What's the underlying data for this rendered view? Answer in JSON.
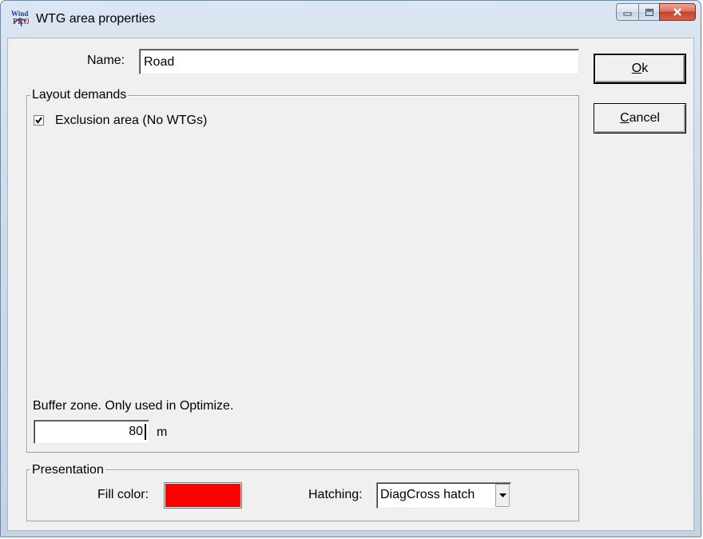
{
  "window": {
    "title": "WTG area properties",
    "icon": "windpro-app-icon",
    "controls": {
      "minimize": "minimize-icon",
      "maximize": "maximize-icon",
      "close": "close-icon"
    }
  },
  "form": {
    "name_label": "Name:",
    "name_value": "Road"
  },
  "buttons": {
    "ok_prefix": "",
    "ok_underlined": "O",
    "ok_rest": "k",
    "cancel_underlined": "C",
    "cancel_rest": "ancel"
  },
  "layout_demands": {
    "group_title": "Layout demands",
    "exclusion_label": "Exclusion area (No WTGs)",
    "exclusion_checked": true,
    "buffer_label": "Buffer zone. Only used in Optimize.",
    "buffer_value": "80",
    "buffer_unit": "m"
  },
  "presentation": {
    "group_title": "Presentation",
    "fill_label": "Fill color:",
    "fill_color": "#ff0000",
    "hatching_label": "Hatching:",
    "hatching_value": "DiagCross hatch"
  }
}
